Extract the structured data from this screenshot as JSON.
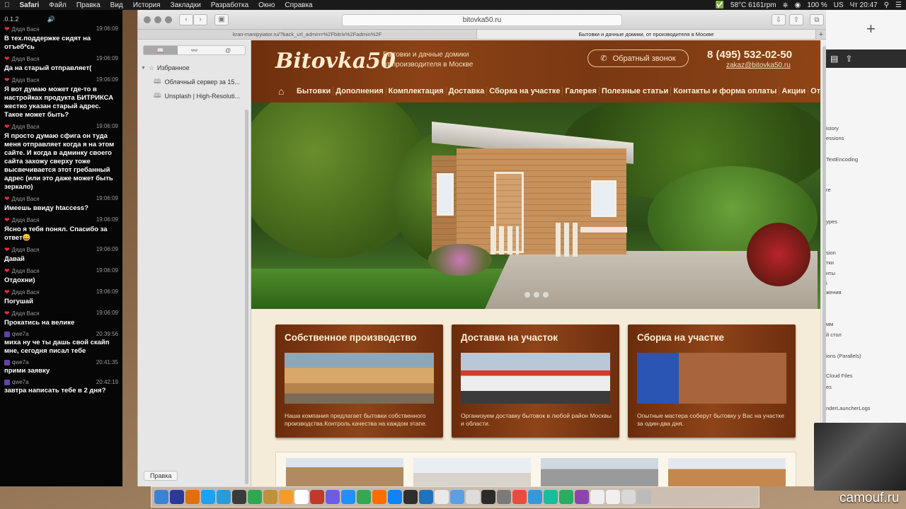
{
  "menubar": {
    "items": [
      "Safari",
      "Файл",
      "Правка",
      "Вид",
      "История",
      "Закладки",
      "Разработка",
      "Окно",
      "Справка"
    ],
    "temperature": "58°C 6161rpm",
    "battery": "100 %",
    "input_lang": "US",
    "clock": "Чт 20:47"
  },
  "chat": {
    "version": ".0.1.2",
    "messages": [
      {
        "user": "Дядя Вася",
        "time": "19:06:09",
        "text": "В тех.поддержке сидят на отъеб*сь",
        "kind": "heart"
      },
      {
        "user": "Дядя Вася",
        "time": "19:06:09",
        "text": "Да на старый отправляет(",
        "kind": "heart"
      },
      {
        "user": "Дядя Вася",
        "time": "19:06:09",
        "text": "Я вот думаю может где-то в настройках продукта БИТРИКСА жестко указан старый адрес. Такое может быть?",
        "kind": "heart"
      },
      {
        "user": "Дядя Вася",
        "time": "19:06:09",
        "text": "Я просто думаю сфига он туда меня отправляет когда я на этом сайте. И когда в админку своего сайта захожу сверху тоже высвечивается этот гребанный адрес (или это даже может быть зеркало)",
        "kind": "heart"
      },
      {
        "user": "Дядя Вася",
        "time": "19:06:09",
        "text": "Имеешь ввиду htaccess?",
        "kind": "heart"
      },
      {
        "user": "Дядя Вася",
        "time": "19:06:09",
        "text": "Ясно я тебя понял. Спасибо за ответ😀",
        "kind": "heart"
      },
      {
        "user": "Дядя Вася",
        "time": "19:06:09",
        "text": "Давай",
        "kind": "heart"
      },
      {
        "user": "Дядя Вася",
        "time": "19:06:09",
        "text": "Отдохни)",
        "kind": "heart"
      },
      {
        "user": "Дядя Вася",
        "time": "19:06:09",
        "text": "Погушай",
        "kind": "heart"
      },
      {
        "user": "Дядя Вася",
        "time": "19:06:09",
        "text": "Прокатись на велике",
        "kind": "heart"
      },
      {
        "user": "qwe7a",
        "time": "20:39:56",
        "text": "миха ну че ты дашь свой скайп мне, сегодня писал тебе",
        "kind": "twitch"
      },
      {
        "user": "qwe7a",
        "time": "20:41:35",
        "text": "прими заявку",
        "kind": "twitch"
      },
      {
        "user": "qwe7a",
        "time": "20:42:19",
        "text": "завтра написать тебе в 2 дня?",
        "kind": "twitch"
      }
    ]
  },
  "browser": {
    "url": "bitovka50.ru",
    "tabs": [
      {
        "label": "kran-manipyiator.ru/?back_url_admin=%2Fbitrix%2Fadmin%2F",
        "active": false
      },
      {
        "label": "Бытовки и дачные домики, от производителя в Москве",
        "active": true
      }
    ]
  },
  "sidebar": {
    "segments": [
      "📖",
      "👓",
      "@"
    ],
    "favorites_label": "Избранное",
    "bookmarks": [
      "Облачный сервер за 15...",
      "Unsplash | High-Resoluti..."
    ],
    "edit_button": "Правка"
  },
  "site": {
    "logo": "Bitovka50",
    "tagline_1": "Бытовки и дачные домики",
    "tagline_2": "от производителя в Москве",
    "callback": "Обратный звонок",
    "phone": "8 (495) 532-02-50",
    "email": "zakaz@bitovka50.ru",
    "nav": [
      "Бытовки",
      "Дополнения",
      "Комплектация",
      "Доставка",
      "Сборка на участке",
      "Галерея",
      "Полезные статьи",
      "Контакты и форма оплаты",
      "Акции",
      "Отзывы"
    ],
    "cards": [
      {
        "title": "Собственное производство",
        "text": "Наша компания предлагает бытовки собственного производства.Контроль качества на каждом этапе.",
        "photo": "lumber-stack"
      },
      {
        "title": "Доставка на участок",
        "text": "Организуем доставку бытовок в любой район Москвы и области.",
        "photo": "crane-truck"
      },
      {
        "title": "Сборка на участке",
        "text": "Опытные мастера соберут бытовку у Вас на участке за один-два дня.",
        "photo": "van-cabin"
      }
    ]
  },
  "rightwin": {
    "items": [
      "istory",
      "essions",
      "TextEncoding",
      "re",
      "ypes",
      "sion",
      "тки",
      "нты",
      "i",
      "жения",
      "мм",
      "й стол",
      "ions (Parallels)",
      "Cloud Files",
      "es",
      "nderLauncherLogs"
    ]
  },
  "watermark": "camouf.ru",
  "colors": {
    "wood_dark": "#6e2f0e",
    "wood_mid": "#8c4216",
    "cream": "#fcefd3",
    "page_bg": "#f4ecd9"
  }
}
